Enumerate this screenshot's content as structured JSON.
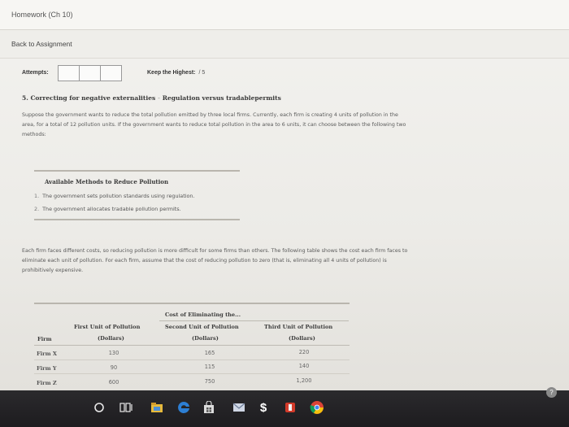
{
  "header": {
    "title": "Homework (Ch 10)"
  },
  "nav": {
    "back_label": "Back to Assignment"
  },
  "attempts": {
    "label": "Attempts:",
    "keep_label": "Keep the Highest:",
    "keep_value": "/ 5"
  },
  "question": {
    "title": "5. Correcting for negative externalities",
    "dash": "-",
    "subtitle": "Regulation versus tradablepermits",
    "intro_line1": "Suppose the government wants to reduce the total pollution emitted by three local firms. Currently, each firm is creating 4 units of pollution in the",
    "intro_line2": "area, for a total of 12 pollution units. If the government wants to reduce total pollution in the area to 6 units, it can choose between the following two",
    "intro_line3": "methods:"
  },
  "methods": {
    "title": "Available Methods to Reduce Pollution",
    "items": [
      {
        "num": "1.",
        "text": "The government sets pollution standards using regulation."
      },
      {
        "num": "2.",
        "text": "The government allocates tradable pollution permits."
      }
    ]
  },
  "cost_para": {
    "line1": "Each firm faces different costs, so reducing pollution is more difficult for some firms than others. The following table shows the cost each firm faces to",
    "line2": "eliminate each unit of pollution. For each firm, assume that the cost of reducing pollution to zero (that is, eliminating all 4 units of pollution) is",
    "line3": "prohibitively expensive."
  },
  "table": {
    "group_header": "Cost of Eliminating the...",
    "firm_header": "Firm",
    "columns": [
      {
        "name": "First Unit of Pollution",
        "unit": "(Dollars)"
      },
      {
        "name": "Second Unit of Pollution",
        "unit": "(Dollars)"
      },
      {
        "name": "Third Unit of Pollution",
        "unit": "(Dollars)"
      }
    ],
    "rows": [
      {
        "firm": "Firm X",
        "values": [
          "130",
          "165",
          "220"
        ]
      },
      {
        "firm": "Firm Y",
        "values": [
          "90",
          "115",
          "140"
        ]
      },
      {
        "firm": "Firm Z",
        "values": [
          "600",
          "750",
          "1,200"
        ]
      }
    ]
  },
  "taskbar": {
    "icons": [
      "start-circle-icon",
      "task-view-icon",
      "file-explorer-icon",
      "edge-browser-icon",
      "store-icon",
      "mail-icon",
      "dollar-app-icon",
      "office-app-icon",
      "chrome-icon"
    ],
    "dollar_glyph": "$"
  },
  "help": {
    "glyph": "?"
  },
  "colors": {
    "taskbar": "#1d1c1f",
    "edge": "#2d7fd4",
    "chrome_yellow": "#f4c20d",
    "chrome_red": "#db4437",
    "office_red": "#d23a2a"
  }
}
